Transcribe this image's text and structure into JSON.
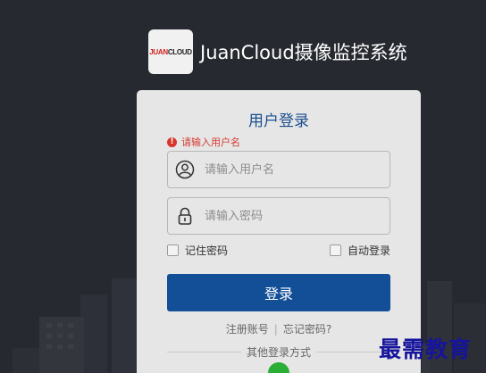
{
  "header": {
    "logo_text_red": "JUAN",
    "logo_text_dark": "CLOUD",
    "app_title": "JuanCloud摄像监控系统"
  },
  "login": {
    "title": "用户登录",
    "error_message": "请输入用户名",
    "username_placeholder": "请输入用户名",
    "password_placeholder": "请输入密码",
    "remember_password": "记住密码",
    "auto_login": "自动登录",
    "login_button": "登录",
    "register_link": "注册账号",
    "link_separator": "|",
    "forgot_link": "忘记密码?",
    "other_login": "其他登录方式"
  },
  "icons": {
    "user": "user-icon",
    "lock": "lock-icon",
    "error": "error-icon",
    "wechat": "wechat-icon"
  },
  "colors": {
    "background": "#262930",
    "accent": "#124f97",
    "title": "#1a4f8f",
    "error": "#d43a2f",
    "wechat": "#2aae35"
  },
  "watermark": "最需教育"
}
